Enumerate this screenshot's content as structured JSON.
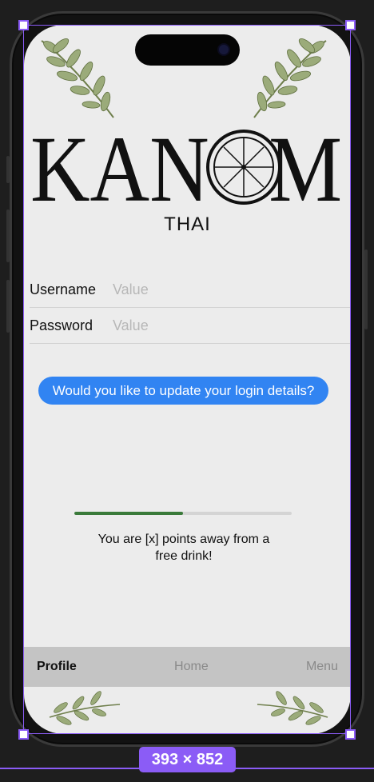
{
  "logo": {
    "word": "KANOM",
    "sub": "THAI"
  },
  "form": {
    "username": {
      "label": "Username",
      "placeholder": "Value"
    },
    "password": {
      "label": "Password",
      "placeholder": "Value"
    }
  },
  "update_button": {
    "label": "Would you like to update your login details?"
  },
  "progress": {
    "fraction": 0.5
  },
  "points_message": "You are [x] points away from a free drink!",
  "tabs": [
    {
      "label": "Profile",
      "active": true
    },
    {
      "label": "Home",
      "active": false
    },
    {
      "label": "Menu",
      "active": false
    }
  ],
  "frame_size": "393 × 852",
  "colors": {
    "screen_bg": "#ececec",
    "accent_blue": "#3184f2",
    "progress_green": "#3a7a3a",
    "tab_bar_bg": "#c4c4c4",
    "selection_purple": "#8b5cf6"
  }
}
